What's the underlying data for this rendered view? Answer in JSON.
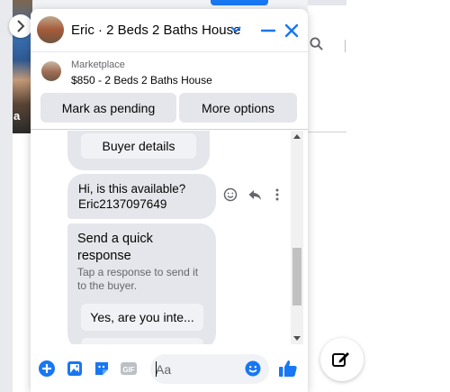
{
  "colors": {
    "accent": "#1877f2",
    "bubble": "#e4e6eb",
    "secondary_text": "#65676b"
  },
  "background": {
    "photo_label": "a",
    "search_icon": "search-icon",
    "compose_icon": "compose-icon",
    "nav_icon": "chevron-right-icon"
  },
  "chat": {
    "header": {
      "title": "Eric · 2 Beds 2 Baths House",
      "icons": [
        "chevron-down-icon",
        "minimize-icon",
        "close-icon"
      ]
    },
    "listing": {
      "kicker": "Marketplace",
      "title": "$850 - 2 Beds 2 Baths House",
      "mark_pending_label": "Mark as pending",
      "more_options_label": "More options"
    },
    "messages": {
      "buyer_details_label": "Buyer details",
      "question": "Hi, is this available?\nEric2137097649",
      "quick_title": "Send a quick\nresponse",
      "quick_subtitle": "Tap a response to send it\nto the buyer.",
      "quick_reply_1": "Yes, are you inte...",
      "action_icons": [
        "emoji-icon",
        "reply-icon",
        "more-icon"
      ]
    },
    "composer": {
      "placeholder": "Aa",
      "icons": [
        "plus-icon",
        "photo-icon",
        "sticker-icon",
        "gif-icon",
        "emoji-icon",
        "like-icon"
      ],
      "gif_label": "GIF"
    }
  }
}
